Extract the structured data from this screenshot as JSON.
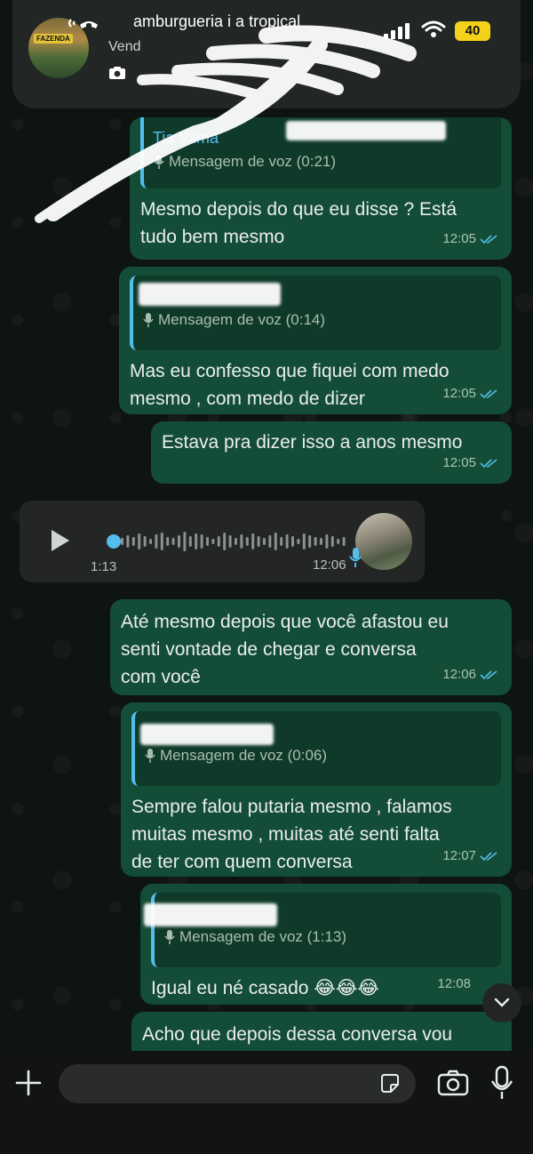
{
  "status_bar": {
    "battery": "40"
  },
  "header": {
    "contact_name": "amburgueria i a tropical",
    "contact_sub": "Vend",
    "avatar_label": "FAZENDA"
  },
  "messages": [
    {
      "type": "reply",
      "quote_name": "Tia Vilma",
      "quote_voice": "Mensagem de voz (0:21)",
      "text_lines": [
        "Mesmo depois do que eu disse ? Está",
        "tudo bem mesmo"
      ],
      "time": "12:05"
    },
    {
      "type": "reply",
      "quote_name": "",
      "quote_voice": "Mensagem de voz (0:14)",
      "text_lines": [
        "Mas eu confesso que fiquei com medo",
        "mesmo , com medo de dizer"
      ],
      "time": "12:05"
    },
    {
      "type": "text",
      "text_lines": [
        "Estava pra dizer isso a anos mesmo"
      ],
      "time": "12:05"
    },
    {
      "type": "voice_in",
      "duration": "1:13",
      "time": "12:06"
    },
    {
      "type": "text",
      "text_lines": [
        "Até mesmo depois que você afastou eu",
        "senti vontade de chegar e conversa",
        "com você"
      ],
      "time": "12:06"
    },
    {
      "type": "reply",
      "quote_name": "",
      "quote_voice": "Mensagem de voz (0:06)",
      "text_lines": [
        "Sempre falou putaria mesmo , falamos",
        "muitas mesmo , muitas até senti falta",
        "de ter com quem conversa"
      ],
      "time": "12:07"
    },
    {
      "type": "reply",
      "quote_name": "",
      "quote_voice": "Mensagem de voz (1:13)",
      "text_lines": [
        "Igual eu né casado 😂😂😂"
      ],
      "time": "12:08"
    },
    {
      "type": "text",
      "text_lines": [
        "Acho que depois dessa conversa vou"
      ],
      "time": ""
    }
  ],
  "composer": {
    "placeholder": ""
  },
  "colors": {
    "outgoing_bubble": "#144d37",
    "incoming_bubble": "#242626",
    "accent_blue": "#53bdeb",
    "read_ticks": "#53bdeb"
  },
  "icons": [
    "call-icon",
    "camera-icon",
    "signal-icon",
    "wifi-icon",
    "mic-icon",
    "play-icon",
    "plus-icon",
    "sticker-icon",
    "chevron-down-icon",
    "double-tick-icon"
  ]
}
